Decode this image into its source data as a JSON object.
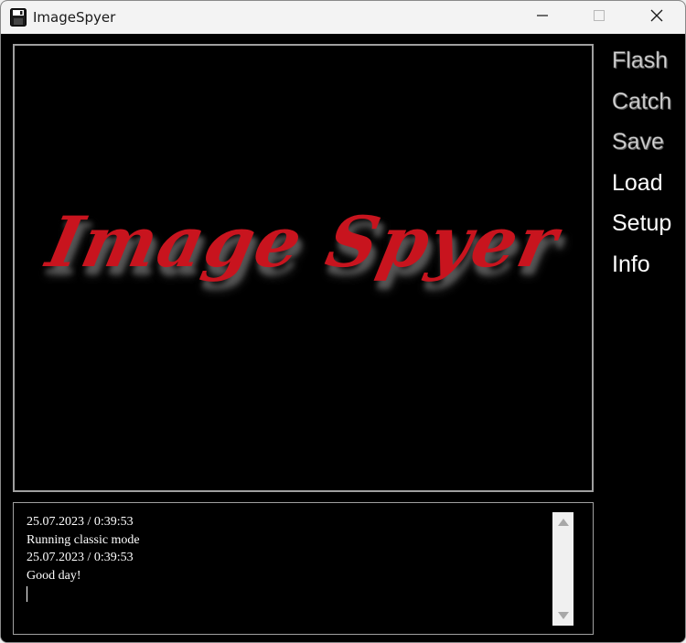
{
  "window": {
    "title": "ImageSpyer",
    "icon": "floppy-disk-icon",
    "controls": [
      "minimize-icon",
      "maximize-icon",
      "close-icon"
    ]
  },
  "image_panel": {
    "logo_text": "Image Spyer",
    "logo_color": "#c8141e"
  },
  "menu": {
    "items": [
      {
        "label": "Flash",
        "state": "disabled"
      },
      {
        "label": "Catch",
        "state": "disabled"
      },
      {
        "label": "Save",
        "state": "disabled"
      },
      {
        "label": "Load",
        "state": "enabled"
      },
      {
        "label": "Setup",
        "state": "enabled"
      },
      {
        "label": "Info",
        "state": "enabled"
      }
    ]
  },
  "log": {
    "lines": [
      "25.07.2023 / 0:39:53",
      "Running classic mode",
      "25.07.2023 / 0:39:53",
      "Good day!"
    ]
  },
  "colors": {
    "background": "#000000",
    "panel_border": "#a0a0a0",
    "titlebar": "#f3f3f3"
  }
}
